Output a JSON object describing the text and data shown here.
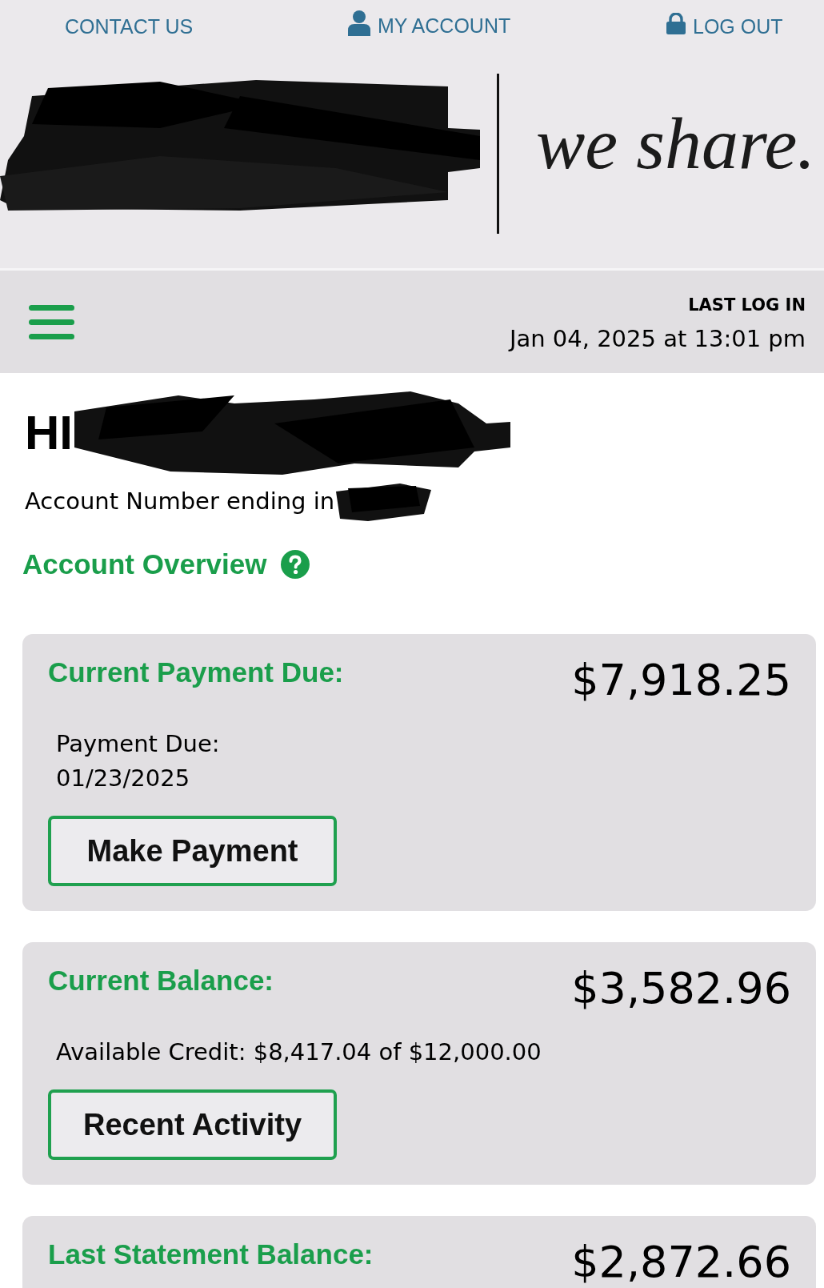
{
  "top_links": [
    {
      "label": "CONTACT US",
      "kind": "contact"
    },
    {
      "label": "MY ACCOUNT",
      "kind": "account"
    },
    {
      "label": "LOG OUT",
      "kind": "logout"
    }
  ],
  "logo": {
    "redacted": true,
    "tagline": "we share."
  },
  "login_bar": {
    "label": "LAST LOG IN",
    "datetime": "Jan 04, 2025 at 13:01 pm"
  },
  "greeting": {
    "text": "HI",
    "redacted": true
  },
  "account_number": {
    "text": "Account Number ending in",
    "redacted": true
  },
  "section_title": "Account Overview",
  "cards": [
    {
      "title": "Current Payment Due:",
      "amount": "$7,918.25",
      "details": [
        "Payment Due:",
        "01/23/2025"
      ],
      "button": "Make Payment"
    },
    {
      "title": "Current Balance:",
      "amount": "$3,582.96",
      "details": [
        "Available Credit: $8,417.04 of $12,000.00"
      ],
      "button": "Recent Activity"
    },
    {
      "title": "Last Statement Balance:",
      "amount": "$2,872.66"
    }
  ]
}
